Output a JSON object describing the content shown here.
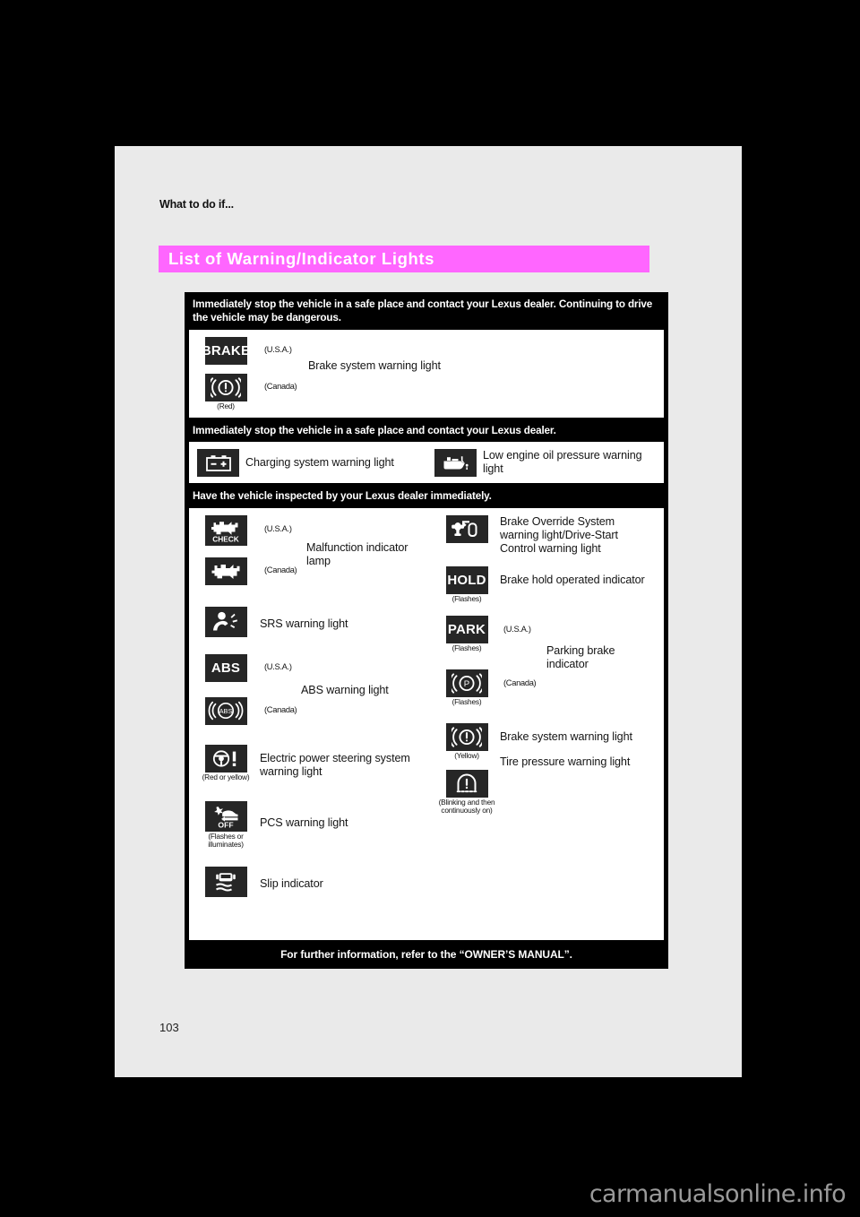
{
  "page": {
    "running_head": "What to do if...",
    "section_title": "List of Warning/Indicator Lights",
    "page_number": "103",
    "watermark": "carmanualsonline.info",
    "footer_note": "For further information, refer to the “OWNER’S MANUAL”.",
    "accent_color": "#ff66ff",
    "tile_color": "#262626",
    "sheet_color": "#eaeaea"
  },
  "groups": [
    {
      "header": "Immediately stop the vehicle in a safe place and contact your Lexus dealer. Continuing to drive the vehicle may be dangerous.",
      "rows": [
        {
          "description": "Brake system warning light",
          "variants": [
            {
              "icon": "brake-text-icon",
              "tile_label": "BRAKE",
              "region": "(U.S.A.)",
              "sub": ""
            },
            {
              "icon": "brake-circle-icon",
              "tile_label": "",
              "region": "(Canada)",
              "sub": "(Red)"
            }
          ]
        }
      ]
    },
    {
      "header": "Immediately stop the vehicle in a safe place and contact your Lexus dealer.",
      "rows": [
        {
          "description": "Charging system warning light",
          "icon": "battery-icon"
        },
        {
          "description": "Low engine oil pressure warning light",
          "icon": "oil-can-icon"
        }
      ]
    },
    {
      "header": "Have the vehicle inspected by your Lexus dealer immediately.",
      "left_column": [
        {
          "description": "Malfunction indicator lamp",
          "variants": [
            {
              "icon": "engine-check-icon",
              "tile_label": "CHECK",
              "region": "(U.S.A.)",
              "sub": ""
            },
            {
              "icon": "engine-icon",
              "tile_label": "",
              "region": "(Canada)",
              "sub": ""
            }
          ]
        },
        {
          "description": "SRS warning light",
          "icon": "srs-airbag-icon",
          "sub": ""
        },
        {
          "description": "ABS warning light",
          "variants": [
            {
              "icon": "abs-text-icon",
              "tile_label": "ABS",
              "region": "(U.S.A.)",
              "sub": ""
            },
            {
              "icon": "abs-circle-icon",
              "tile_label": "",
              "region": "(Canada)",
              "sub": ""
            }
          ]
        },
        {
          "description": "Electric power steering system warning light",
          "icon": "steering-wheel-icon",
          "sub": "(Red or yellow)"
        },
        {
          "description": "PCS warning light",
          "icon": "pcs-off-icon",
          "sub": "(Flashes or illuminates)"
        },
        {
          "description": "Slip indicator",
          "icon": "slip-indicator-icon",
          "sub": ""
        }
      ],
      "right_column": [
        {
          "description": "Brake Override System warning light/Drive-Start Control warning light",
          "icon": "brake-override-icon",
          "sub": ""
        },
        {
          "description": "Brake hold operated indicator",
          "icon": "hold-text-icon",
          "tile_label": "HOLD",
          "sub": "(Flashes)"
        },
        {
          "description": "Parking brake indicator",
          "variants": [
            {
              "icon": "park-text-icon",
              "tile_label": "PARK",
              "region": "(U.S.A.)",
              "sub": "(Flashes)"
            },
            {
              "icon": "park-circle-icon",
              "tile_label": "",
              "region": "(Canada)",
              "sub": "(Flashes)"
            }
          ]
        },
        {
          "description": "Brake system warning light",
          "icon": "brake-circle-icon",
          "sub": "(Yellow)"
        },
        {
          "description": "Tire pressure warning light",
          "icon": "tire-pressure-icon",
          "sub": "(Blinking and then continuously on)"
        }
      ]
    }
  ]
}
